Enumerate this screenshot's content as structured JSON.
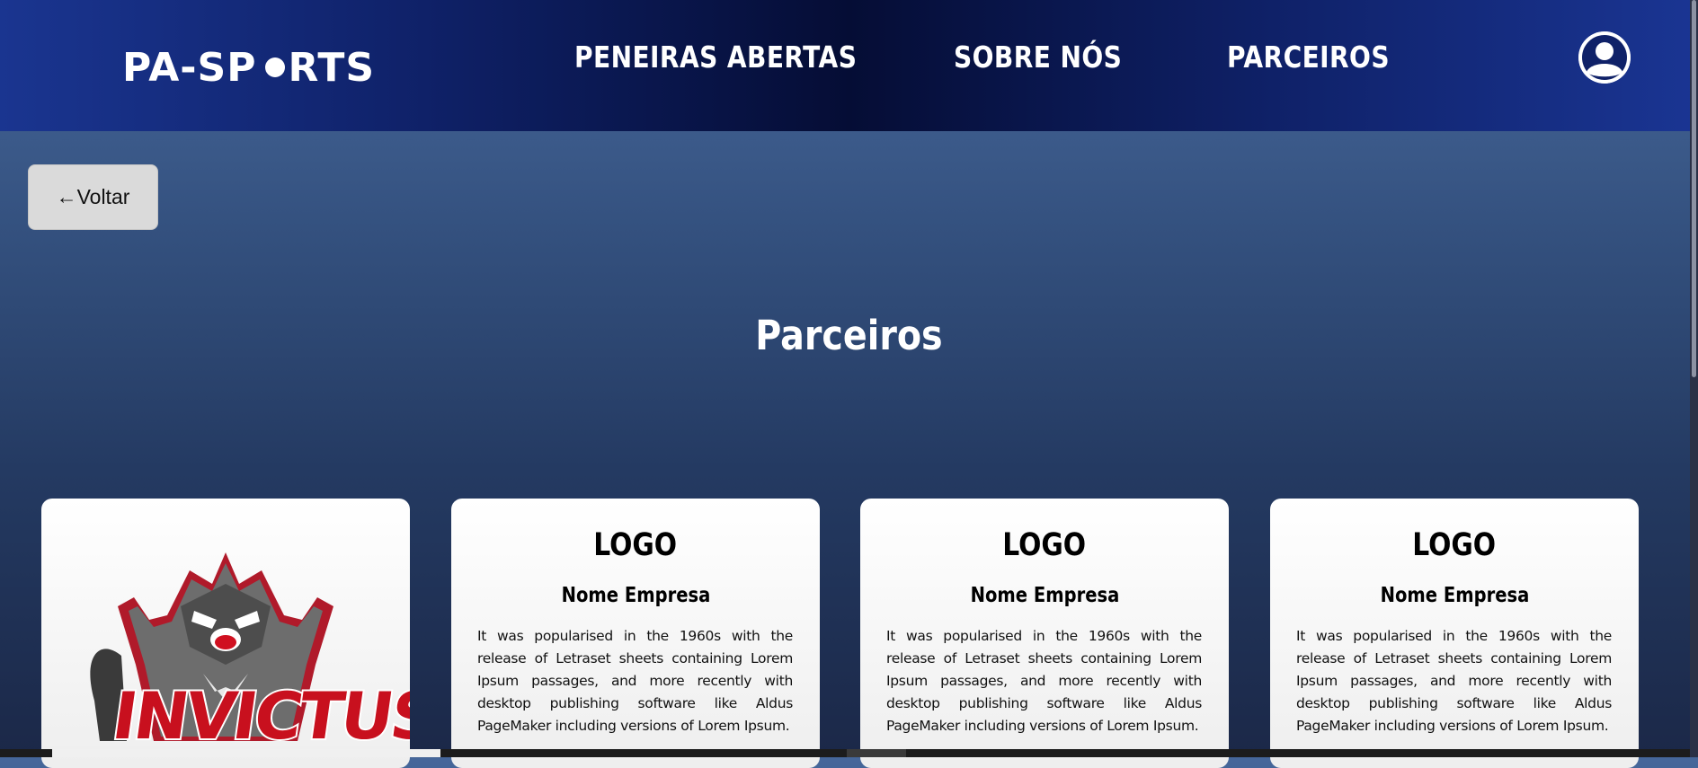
{
  "header": {
    "brand": "PA-SP",
    "brand_tail": "RTS",
    "nav": [
      "PENEIRAS ABERTAS",
      "SOBRE NÓS",
      "PARCEIROS"
    ]
  },
  "back_button": "←Voltar",
  "page_title": "Parceiros",
  "cards": [
    {
      "image": "INVICTUS raccoon mascot logo",
      "logo_text": "INVICTUS"
    },
    {
      "logo": "LOGO",
      "name": "Nome Empresa",
      "description": "It was popularised in the 1960s with the release of Letraset sheets containing Lorem Ipsum passages, and more recently with desktop publishing software like Aldus PageMaker including versions of Lorem Ipsum."
    },
    {
      "logo": "LOGO",
      "name": "Nome Empresa",
      "description": "It was popularised in the 1960s with the release of Letraset sheets containing Lorem Ipsum passages, and more recently with desktop publishing software like Aldus PageMaker including versions of Lorem Ipsum."
    },
    {
      "logo": "LOGO",
      "name": "Nome Empresa",
      "description": "It was popularised in the 1960s with the release of Letraset sheets containing Lorem Ipsum passages, and more recently with desktop publishing software like Aldus PageMaker including versions of Lorem Ipsum."
    }
  ],
  "icons": {
    "profile": "user-circle-icon",
    "mascot": "raccoon-mascot-icon"
  },
  "colors": {
    "header_dark": "#050d35",
    "header_blue": "#1a3590",
    "card_bg": "#ffffff",
    "button_bg": "#dadada"
  }
}
